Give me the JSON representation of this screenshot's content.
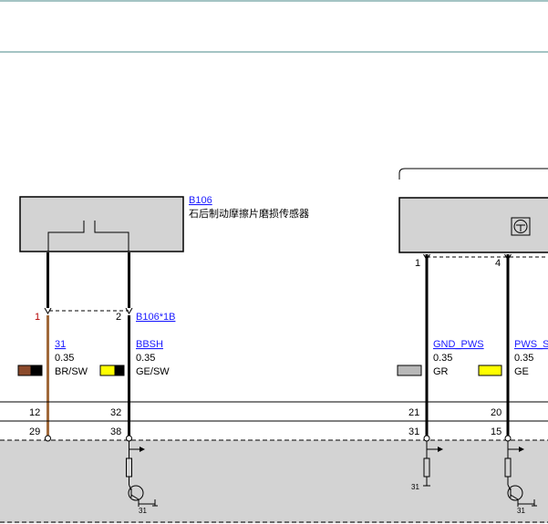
{
  "components": [
    {
      "id": "B106",
      "description": "石后制动摩擦片磨损传感器"
    },
    {
      "id": "module_right"
    }
  ],
  "connector": {
    "id": "B106*1B"
  },
  "pins": {
    "b106_pin_1": "1",
    "b106_pin_2": "2",
    "right_pin_1": "1",
    "right_pin_4": "4"
  },
  "wires": [
    {
      "signal": "31",
      "size": "0.35",
      "color_code": "BR/SW",
      "swatch_colors": [
        "#8b4a2b",
        "#000000"
      ],
      "wire_color": "#a0693a",
      "numbers": [
        "12",
        "29"
      ]
    },
    {
      "signal": "BBSH",
      "size": "0.35",
      "color_code": "GE/SW",
      "swatch_colors": [
        "#ffff00",
        "#000000"
      ],
      "wire_color": "#000000",
      "numbers": [
        "32",
        "38"
      ]
    },
    {
      "signal": "GND_PWS",
      "size": "0.35",
      "color_code": "GR",
      "swatch_colors": [
        "#b8b8b8"
      ],
      "wire_color": "#000000",
      "numbers": [
        "21",
        "31"
      ]
    },
    {
      "signal": "PWS_S",
      "size": "0.35",
      "color_code": "GE",
      "swatch_colors": [
        "#ffff00"
      ],
      "wire_color": "#000000",
      "numbers": [
        "20",
        "15"
      ]
    }
  ],
  "ground_labels": {
    "left_transistor_ground": "31",
    "right_resistor_ground": "31",
    "right_transistor_ground": "31"
  },
  "colors": {
    "header_rule": "#4a8a88",
    "box_fill": "#d3d3d3",
    "link": "#1a1aff"
  }
}
